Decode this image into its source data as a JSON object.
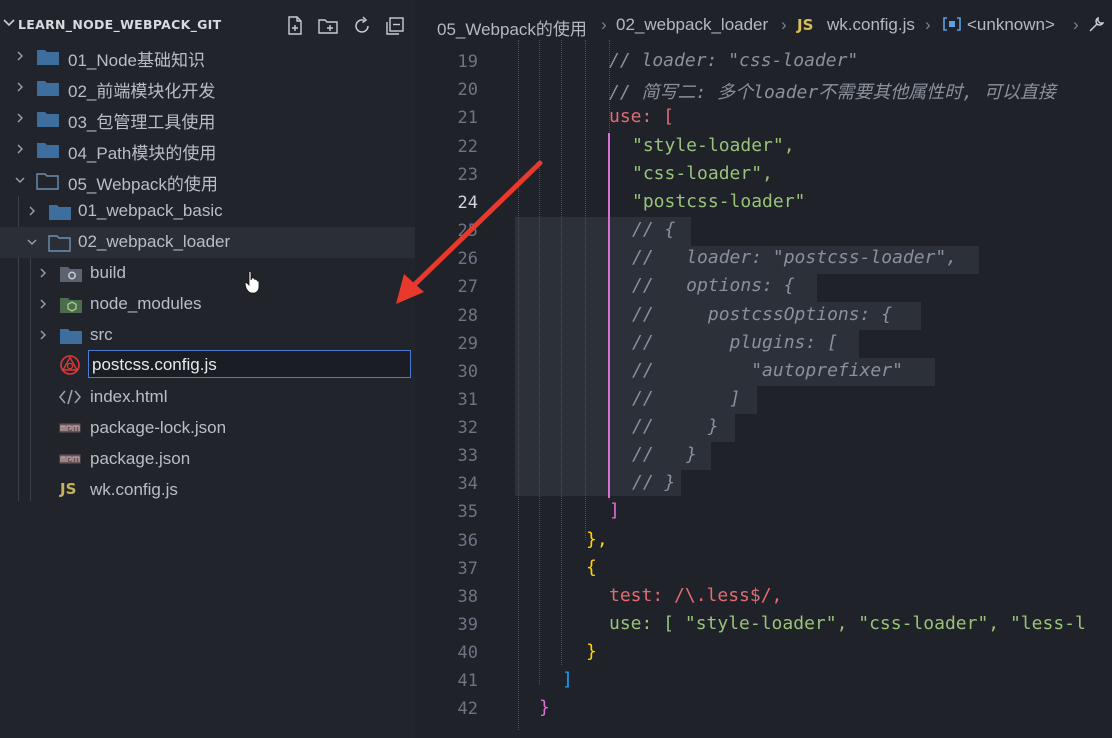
{
  "explorer": {
    "title": "LEARN_NODE_WEBPACK_GIT",
    "header_icons": [
      "new-file-icon",
      "new-folder-icon",
      "refresh-icon",
      "collapse-all-icon"
    ],
    "items": [
      {
        "label": "01_Node基础知识",
        "type": "folder",
        "expanded": false
      },
      {
        "label": "02_前端模块化开发",
        "type": "folder",
        "expanded": false
      },
      {
        "label": "03_包管理工具使用",
        "type": "folder",
        "expanded": false
      },
      {
        "label": "04_Path模块的使用",
        "type": "folder",
        "expanded": false
      },
      {
        "label": "05_Webpack的使用",
        "type": "folder",
        "expanded": true
      },
      {
        "label": "01_webpack_basic",
        "type": "folder",
        "expanded": false
      },
      {
        "label": "02_webpack_loader",
        "type": "folder",
        "expanded": true
      },
      {
        "label": "build",
        "type": "folder",
        "expanded": false
      },
      {
        "label": "node_modules",
        "type": "folder",
        "expanded": false
      },
      {
        "label": "src",
        "type": "folder",
        "expanded": false
      },
      {
        "label": "postcss.config.js",
        "type": "file-renaming"
      },
      {
        "label": "index.html",
        "type": "file"
      },
      {
        "label": "package-lock.json",
        "type": "file"
      },
      {
        "label": "package.json",
        "type": "file"
      },
      {
        "label": "wk.config.js",
        "type": "file"
      }
    ],
    "rename_value": "postcss.config.js"
  },
  "breadcrumb": {
    "parts": [
      "05_Webpack的使用",
      "02_webpack_loader",
      "wk.config.js",
      "<unknown>"
    ],
    "js_badge": "JS"
  },
  "code": {
    "current_line": 24,
    "lines": [
      {
        "n": 19,
        "text": "// loader: \"css-loader\""
      },
      {
        "n": 20,
        "text": "// 简写二: 多个loader不需要其他属性时, 可以直接"
      },
      {
        "n": 21,
        "text": "use: ["
      },
      {
        "n": 22,
        "text": "\"style-loader\","
      },
      {
        "n": 23,
        "text": "\"css-loader\","
      },
      {
        "n": 24,
        "text": "\"postcss-loader\""
      },
      {
        "n": 25,
        "text": "// {"
      },
      {
        "n": 26,
        "text": "//   loader: \"postcss-loader\","
      },
      {
        "n": 27,
        "text": "//   options: {"
      },
      {
        "n": 28,
        "text": "//     postcssOptions: {"
      },
      {
        "n": 29,
        "text": "//       plugins: ["
      },
      {
        "n": 30,
        "text": "//         \"autoprefixer\""
      },
      {
        "n": 31,
        "text": "//       ]"
      },
      {
        "n": 32,
        "text": "//     }"
      },
      {
        "n": 33,
        "text": "//   }"
      },
      {
        "n": 34,
        "text": "// }"
      },
      {
        "n": 35,
        "text": "]"
      },
      {
        "n": 36,
        "text": "},"
      },
      {
        "n": 37,
        "text": "{"
      },
      {
        "n": 38,
        "text": "test: /\\.less$/,"
      },
      {
        "n": 39,
        "text": "use: [ \"style-loader\", \"css-loader\", \"less-l"
      },
      {
        "n": 40,
        "text": "}"
      },
      {
        "n": 41,
        "text": "]"
      },
      {
        "n": 42,
        "text": "}"
      }
    ]
  },
  "colors": {
    "sidebar_bg": "#21252b",
    "editor_bg": "#1f2229",
    "rename_border": "#4c7bd2",
    "annotation_arrow": "#e8392c"
  }
}
